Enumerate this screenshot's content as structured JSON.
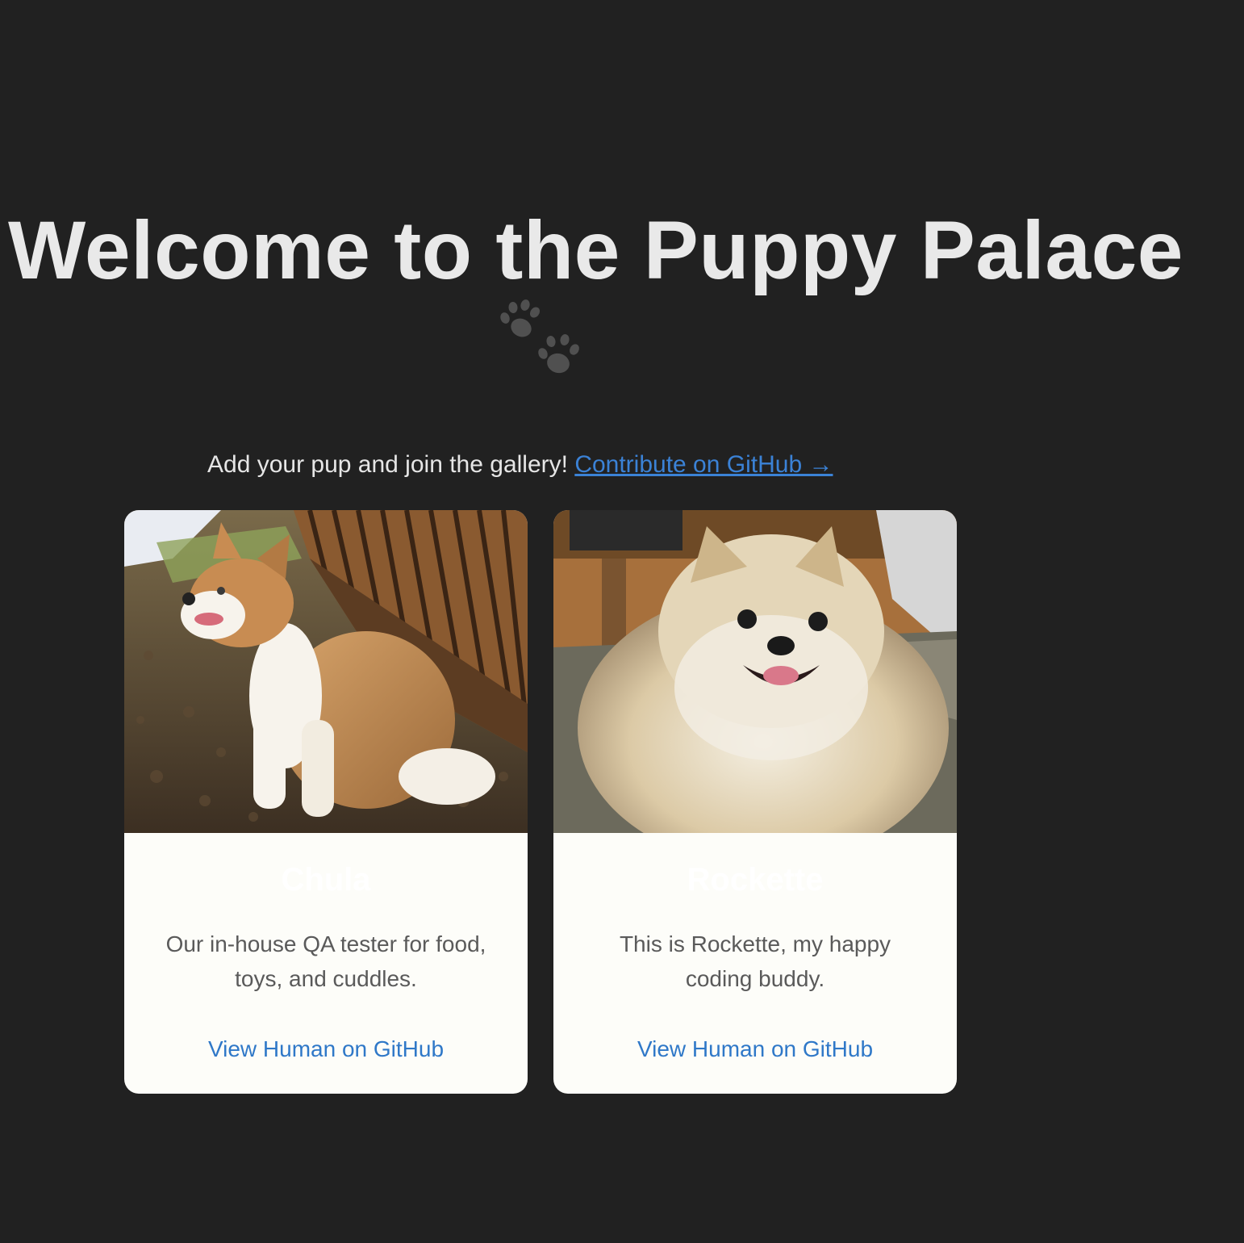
{
  "page": {
    "title": "Welcome to the Puppy Palace",
    "paws_icon": "paw-prints-icon"
  },
  "tagline": {
    "text": "Add your pup and join the gallery!",
    "link_label": "Contribute on GitHub →"
  },
  "puppies": [
    {
      "name": "Chula",
      "description": "Our in-house QA tester for food, toys, and cuddles.",
      "link_label": "View Human on GitHub",
      "photo": "dog-photo"
    },
    {
      "name": "Rockette",
      "description": "This is Rockette, my happy coding buddy.",
      "link_label": "View Human on GitHub",
      "photo": "dog-photo"
    }
  ],
  "colors": {
    "background": "#212121",
    "card": "#fdfdf9",
    "link": "#2f78c8",
    "title": "#e9e9e9"
  }
}
